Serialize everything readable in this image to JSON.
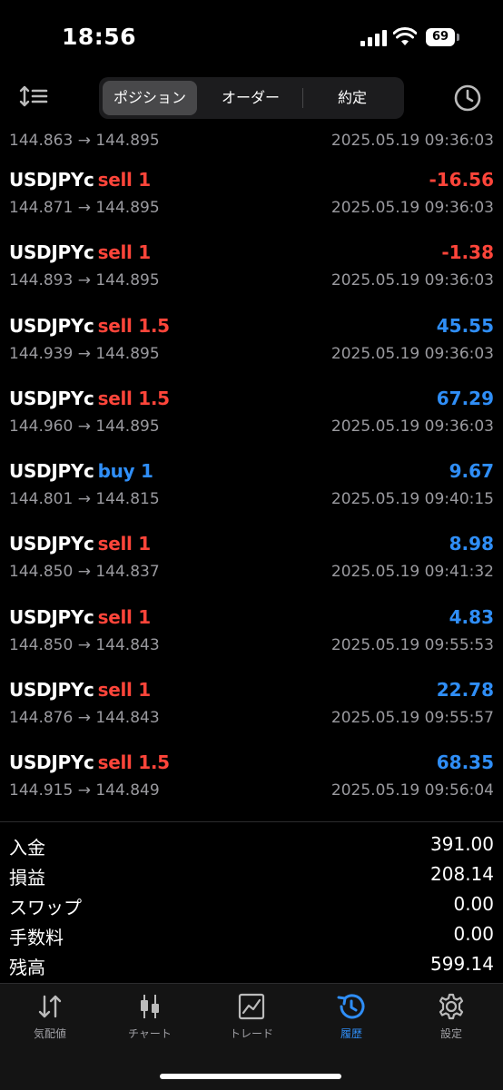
{
  "status_bar": {
    "time": "18:56",
    "battery": "69"
  },
  "toolbar": {
    "tabs": [
      {
        "label": "ポジション",
        "active": true
      },
      {
        "label": "オーダー",
        "active": false
      },
      {
        "label": "約定",
        "active": false
      }
    ],
    "sort_icon": "sort-lines-icon",
    "history_icon": "clock-icon"
  },
  "trades": [
    {
      "prices": "144.863 → 144.895",
      "date": "2025.05.19 09:36:03"
    },
    {
      "symbol": "USDJPYc",
      "side": "sell",
      "volume": "1",
      "profit": "-16.56",
      "prices": "144.871 → 144.895",
      "date": "2025.05.19 09:36:03"
    },
    {
      "symbol": "USDJPYc",
      "side": "sell",
      "volume": "1",
      "profit": "-1.38",
      "prices": "144.893 → 144.895",
      "date": "2025.05.19 09:36:03"
    },
    {
      "symbol": "USDJPYc",
      "side": "sell",
      "volume": "1.5",
      "profit": "45.55",
      "prices": "144.939 → 144.895",
      "date": "2025.05.19 09:36:03"
    },
    {
      "symbol": "USDJPYc",
      "side": "sell",
      "volume": "1.5",
      "profit": "67.29",
      "prices": "144.960 → 144.895",
      "date": "2025.05.19 09:36:03"
    },
    {
      "symbol": "USDJPYc",
      "side": "buy",
      "volume": "1",
      "profit": "9.67",
      "prices": "144.801 → 144.815",
      "date": "2025.05.19 09:40:15"
    },
    {
      "symbol": "USDJPYc",
      "side": "sell",
      "volume": "1",
      "profit": "8.98",
      "prices": "144.850 → 144.837",
      "date": "2025.05.19 09:41:32"
    },
    {
      "symbol": "USDJPYc",
      "side": "sell",
      "volume": "1",
      "profit": "4.83",
      "prices": "144.850 → 144.843",
      "date": "2025.05.19 09:55:53"
    },
    {
      "symbol": "USDJPYc",
      "side": "sell",
      "volume": "1",
      "profit": "22.78",
      "prices": "144.876 → 144.843",
      "date": "2025.05.19 09:55:57"
    },
    {
      "symbol": "USDJPYc",
      "side": "sell",
      "volume": "1.5",
      "profit": "68.35",
      "prices": "144.915 → 144.849",
      "date": "2025.05.19 09:56:04"
    }
  ],
  "summary": [
    {
      "label": "入金",
      "value": "391.00"
    },
    {
      "label": "損益",
      "value": "208.14"
    },
    {
      "label": "スワップ",
      "value": "0.00"
    },
    {
      "label": "手数料",
      "value": "0.00"
    },
    {
      "label": "残高",
      "value": "599.14"
    }
  ],
  "tab_bar": [
    {
      "label": "気配値",
      "icon": "quotes-arrows-icon",
      "active": false
    },
    {
      "label": "チャート",
      "icon": "candlestick-icon",
      "active": false
    },
    {
      "label": "トレード",
      "icon": "trade-chart-icon",
      "active": false
    },
    {
      "label": "履歴",
      "icon": "history-icon",
      "active": true
    },
    {
      "label": "設定",
      "icon": "gear-icon",
      "active": false
    }
  ],
  "colors": {
    "sell": "#ff453a",
    "buy": "#2f8ef7",
    "loss": "#ff453a",
    "gain": "#2f8ef7",
    "muted": "#9a9a9f"
  }
}
